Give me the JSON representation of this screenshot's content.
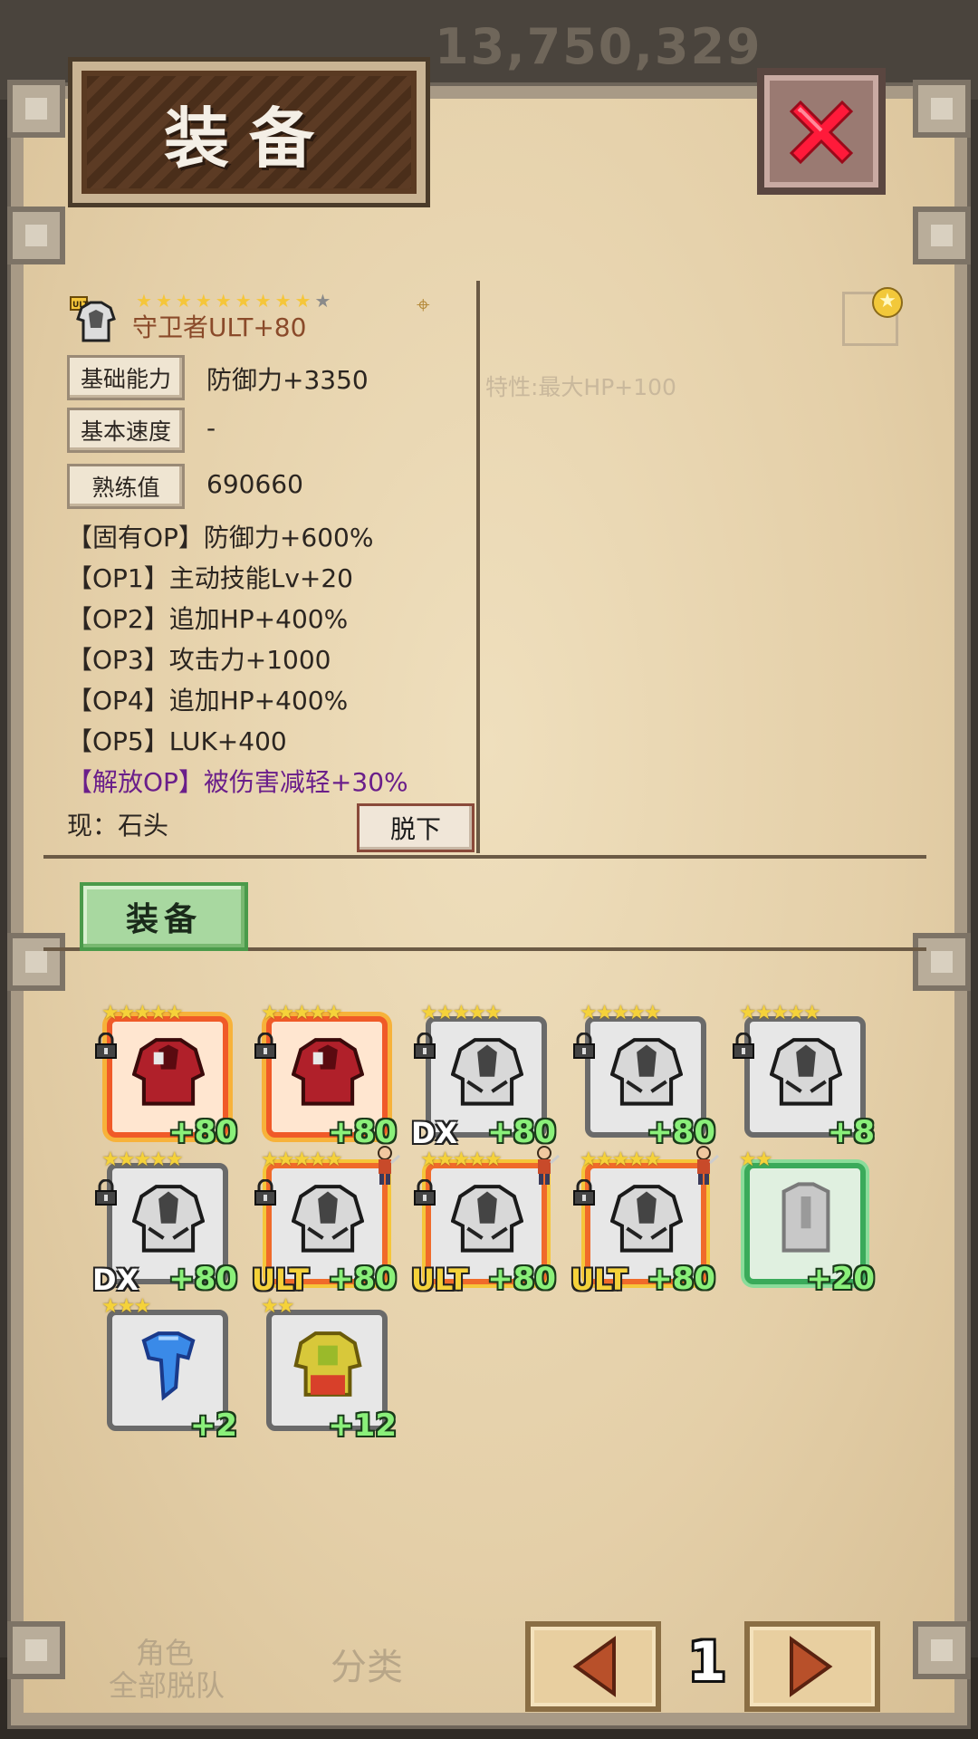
{
  "background": {
    "gold_amount": "13,750,329"
  },
  "title": "装备",
  "detail": {
    "item_name": "守卫者ULT+80",
    "rank_badge": "ULT",
    "stars_filled": 9,
    "stars_total": 10,
    "stats": [
      {
        "label": "基础能力",
        "value": "防御力+3350"
      },
      {
        "label": "基本速度",
        "value": "-"
      },
      {
        "label": "熟练值",
        "value": "690660"
      }
    ],
    "options": [
      {
        "text": "【固有OP】防御力+600%",
        "purple": false
      },
      {
        "text": "【OP1】主动技能Lv+20",
        "purple": false
      },
      {
        "text": "【OP2】追加HP+400%",
        "purple": false
      },
      {
        "text": "【OP3】攻击力+1000",
        "purple": false
      },
      {
        "text": "【OP4】追加HP+400%",
        "purple": false
      },
      {
        "text": "【OP5】LUK+400",
        "purple": false
      },
      {
        "text": "【解放OP】被伤害减轻+30%",
        "purple": true
      }
    ],
    "current": "现：石头",
    "unequip_label": "脱下",
    "right_note": "特性:最大HP+100"
  },
  "equip_label": "装备",
  "inventory": [
    {
      "level": "+80",
      "tag": "",
      "stars": "★★★★★",
      "style": "red",
      "art": "red-armor",
      "locked": true,
      "char": false
    },
    {
      "level": "+80",
      "tag": "",
      "stars": "★★★★★",
      "style": "red",
      "art": "red-armor",
      "locked": true,
      "char": false
    },
    {
      "level": "+80",
      "tag": "DX",
      "stars": "★★★★★",
      "style": "grey",
      "art": "grey-armor",
      "locked": true,
      "char": false
    },
    {
      "level": "+80",
      "tag": "",
      "stars": "★★★★★",
      "style": "grey",
      "art": "grey-armor",
      "locked": true,
      "char": false
    },
    {
      "level": "+8",
      "tag": "",
      "stars": "★★★★★",
      "style": "grey",
      "art": "grey-armor",
      "locked": true,
      "char": false
    },
    {
      "level": "+80",
      "tag": "DX",
      "stars": "★★★★★",
      "style": "grey",
      "art": "grey-armor",
      "locked": true,
      "char": false
    },
    {
      "level": "+80",
      "tag": "ULT",
      "stars": "★★★★★",
      "style": "gold",
      "art": "grey-armor",
      "locked": true,
      "char": true
    },
    {
      "level": "+80",
      "tag": "ULT",
      "stars": "★★★★★",
      "style": "gold",
      "art": "grey-armor",
      "locked": true,
      "char": true
    },
    {
      "level": "+80",
      "tag": "ULT",
      "stars": "★★★★★",
      "style": "gold",
      "art": "grey-armor",
      "locked": true,
      "char": true
    },
    {
      "level": "+20",
      "tag": "",
      "stars": "★★",
      "style": "green",
      "art": "plain-armor",
      "locked": false,
      "char": false
    },
    {
      "level": "+2",
      "tag": "",
      "stars": "★★★",
      "style": "grey",
      "art": "blue-cloth",
      "locked": false,
      "char": false
    },
    {
      "level": "+12",
      "tag": "",
      "stars": "★★",
      "style": "grey",
      "art": "yellow-armor",
      "locked": false,
      "char": false
    }
  ],
  "pagination": {
    "page": "1"
  },
  "footer": {
    "left_a": "角色",
    "left_b": "全部脱队",
    "middle": "分类"
  },
  "colors": {
    "accent_green": "#8af07a",
    "close_red": "#ff1a3a",
    "purple_option": "#6a1e8a"
  }
}
